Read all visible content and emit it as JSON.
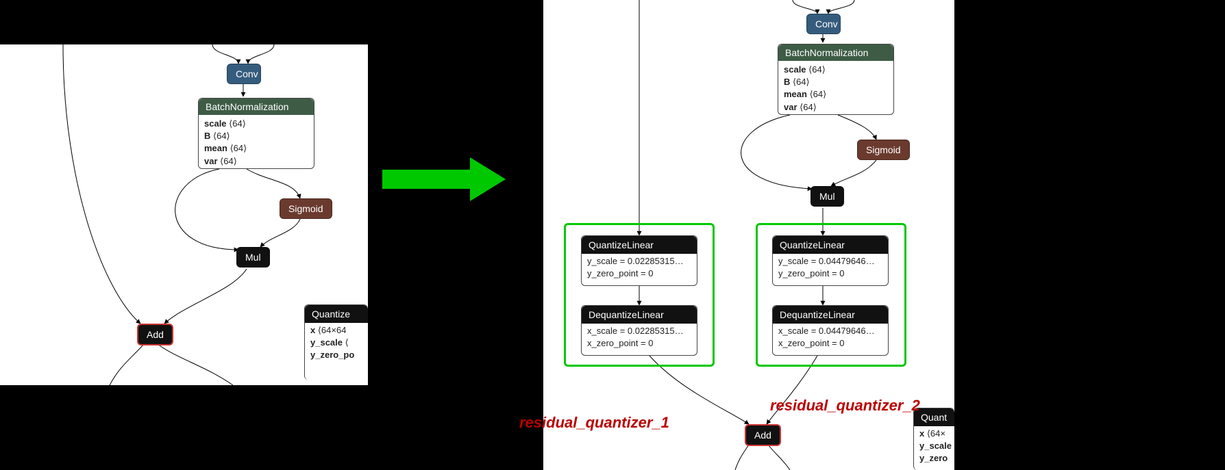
{
  "ops": {
    "conv": "Conv",
    "bn": "BatchNormalization",
    "sigmoid": "Sigmoid",
    "mul": "Mul",
    "add": "Add",
    "ql": "QuantizeLinear",
    "dql": "DequantizeLinear",
    "quant_clipped": "Quantize",
    "quant_clipped2": "Quant"
  },
  "bn_params": {
    "scale_label": "scale",
    "scale_shape": "⟨64⟩",
    "B_label": "B",
    "B_shape": "⟨64⟩",
    "mean_label": "mean",
    "mean_shape": "⟨64⟩",
    "var_label": "var",
    "var_shape": "⟨64⟩"
  },
  "left_q_clipped": {
    "x_label": "x",
    "x_shape": "⟨64×64",
    "yscale_label": "y_scale",
    "yscale_shape": "⟨",
    "yzp_label": "y_zero_po"
  },
  "right_q_clipped": {
    "x_label": "x",
    "x_shape": "⟨64×",
    "yscale_label": "y_scale",
    "yzero_label": "y_zero"
  },
  "q1": {
    "yscale": "y_scale = 0.02285315…",
    "yzp": "y_zero_point = 0"
  },
  "dq1": {
    "xscale": "x_scale = 0.02285315…",
    "xzp": "x_zero_point = 0"
  },
  "q2": {
    "yscale": "y_scale = 0.04479646…",
    "yzp": "y_zero_point = 0"
  },
  "dq2": {
    "xscale": "x_scale = 0.04479646…",
    "xzp": "x_zero_point = 0"
  },
  "labels": {
    "res1": "residual_quantizer_1",
    "res2": "residual_quantizer_2"
  }
}
